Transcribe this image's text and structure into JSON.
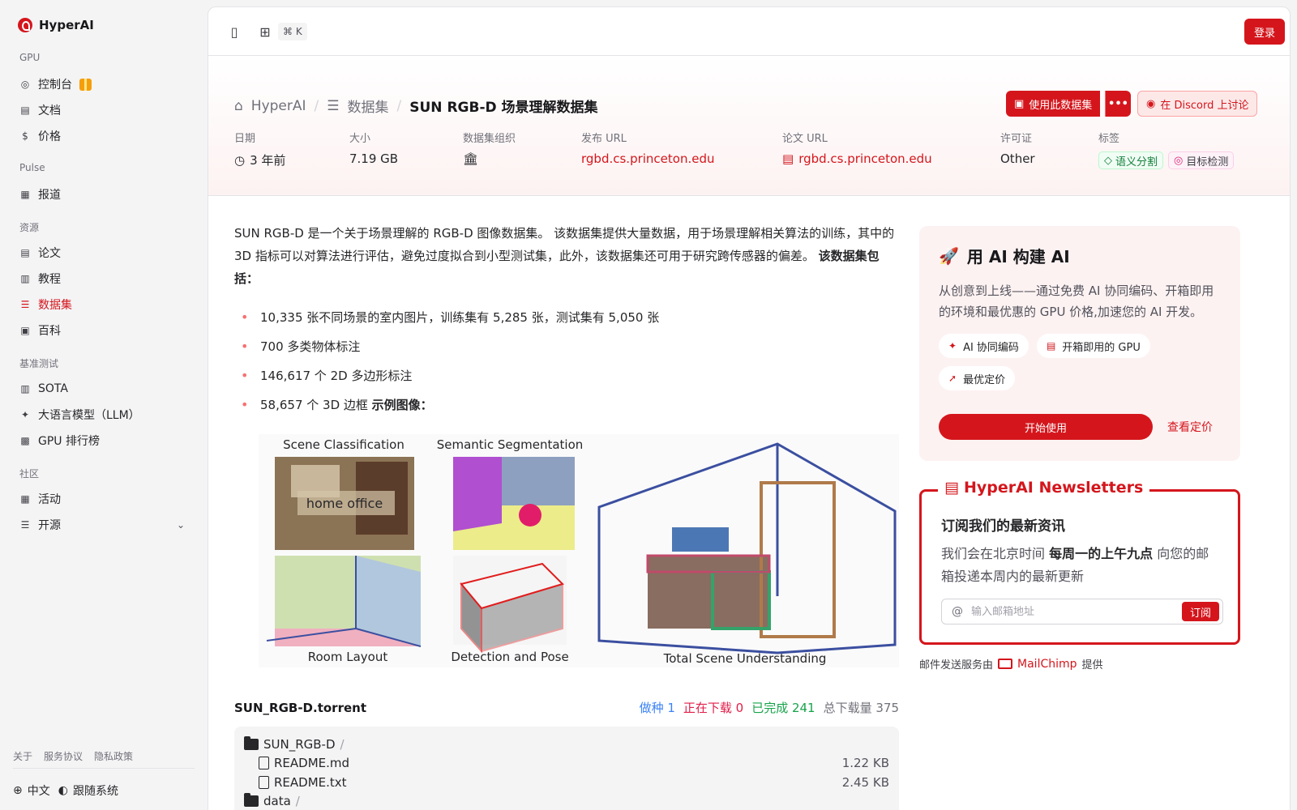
{
  "brand": {
    "name": "HyperAI"
  },
  "sidebar": {
    "sections": [
      {
        "title": "GPU",
        "items": [
          {
            "label": "控制台",
            "icon": "gauge-icon"
          },
          {
            "label": "文档",
            "icon": "doc-icon"
          },
          {
            "label": "价格",
            "icon": "dollar-icon"
          }
        ]
      },
      {
        "title": "Pulse",
        "items": [
          {
            "label": "报道",
            "icon": "newspaper-icon"
          }
        ]
      },
      {
        "title": "资源",
        "items": [
          {
            "label": "论文",
            "icon": "paper-icon"
          },
          {
            "label": "教程",
            "icon": "book-icon"
          },
          {
            "label": "数据集",
            "icon": "database-icon"
          },
          {
            "label": "百科",
            "icon": "wiki-icon"
          }
        ]
      },
      {
        "title": "基准测试",
        "items": [
          {
            "label": "SOTA",
            "icon": "chart-icon"
          },
          {
            "label": "大语言模型（LLM）",
            "icon": "sparkle-icon"
          },
          {
            "label": "GPU 排行榜",
            "icon": "chip-icon"
          }
        ]
      },
      {
        "title": "社区",
        "items": [
          {
            "label": "活动",
            "icon": "calendar-icon"
          },
          {
            "label": "开源",
            "icon": "list-icon"
          }
        ]
      }
    ],
    "footer_links": [
      "关于",
      "服务协议",
      "隐私政策"
    ],
    "language": "中文",
    "theme": "跟随系统"
  },
  "topbar": {
    "shortcut": "⌘ K",
    "login": "登录"
  },
  "breadcrumb": {
    "home": "HyperAI",
    "parent": "数据集",
    "current": "SUN RGB-D 场景理解数据集"
  },
  "actions": {
    "use_dataset": "使用此数据集",
    "more": "•••",
    "discord": "在 Discord 上讨论"
  },
  "meta": {
    "date_label": "日期",
    "date_value": "3 年前",
    "size_label": "大小",
    "size_value": "7.19 GB",
    "org_label": "数据集组织",
    "url_label": "发布 URL",
    "url_value": "rgbd.cs.princeton.edu",
    "paper_label": "论文 URL",
    "paper_value": "rgbd.cs.princeton.edu",
    "license_label": "许可证",
    "license_value": "Other",
    "tags_label": "标签",
    "tags": [
      "语义分割",
      "目标检测"
    ]
  },
  "content": {
    "intro": "SUN RGB-D 是一个关于场景理解的 RGB-D 图像数据集。 该数据集提供大量数据，用于场景理解相关算法的训练，其中的 3D 指标可以对算法进行评估，避免过度拟合到小型测试集，此外，该数据集还可用于研究跨传感器的偏差。",
    "intro_bold": "该数据集包括：",
    "bullets": [
      "10,335 张不同场景的室内图片，训练集有 5,285 张，测试集有 5,050 张",
      "700 多类物体标注",
      "146,617 个 2D 多边形标注",
      "58,657 个 3D 边框"
    ],
    "bullet_bold": "示例图像：",
    "figure_labels": {
      "scene": "Scene Classification",
      "semantic": "Semantic Segmentation",
      "home": "home office",
      "room": "Room Layout",
      "detect": "Detection and Pose",
      "total": "Total Scene Understanding"
    }
  },
  "torrent": {
    "name": "SUN_RGB-D.torrent",
    "seeding": "做种 1",
    "downloading": "正在下载 0",
    "completed": "已完成 241",
    "total": "总下载量 375",
    "files": [
      {
        "name": "SUN_RGB-D",
        "type": "folder",
        "size": "",
        "indent": 0
      },
      {
        "name": "README.md",
        "type": "file",
        "size": "1.22 KB",
        "indent": 1
      },
      {
        "name": "README.txt",
        "type": "file",
        "size": "2.45 KB",
        "indent": 1
      },
      {
        "name": "data",
        "type": "folder",
        "size": "",
        "indent": 0
      }
    ]
  },
  "cta": {
    "title": "用 AI 构建 AI",
    "desc": "从创意到上线——通过免费 AI 协同编码、开箱即用的环境和最优惠的 GPU 价格,加速您的 AI 开发。",
    "chips": [
      "AI 协同编码",
      "开箱即用的 GPU",
      "最优定价"
    ],
    "start": "开始使用",
    "pricing": "查看定价"
  },
  "newsletter": {
    "title": "HyperAI Newsletters",
    "heading": "订阅我们的最新资讯",
    "desc_pre": "我们会在北京时间",
    "desc_bold": "每周一的上午九点",
    "desc_post": "向您的邮箱投递本周内的最新更新",
    "placeholder": "输入邮箱地址",
    "subscribe": "订阅",
    "provider_pre": "邮件发送服务由",
    "provider": "MailChimp",
    "provider_post": "提供"
  },
  "colors": {
    "accent": "#d4161c",
    "seed": "#3b82f6",
    "down": "#e11d48",
    "done": "#16a34a"
  }
}
